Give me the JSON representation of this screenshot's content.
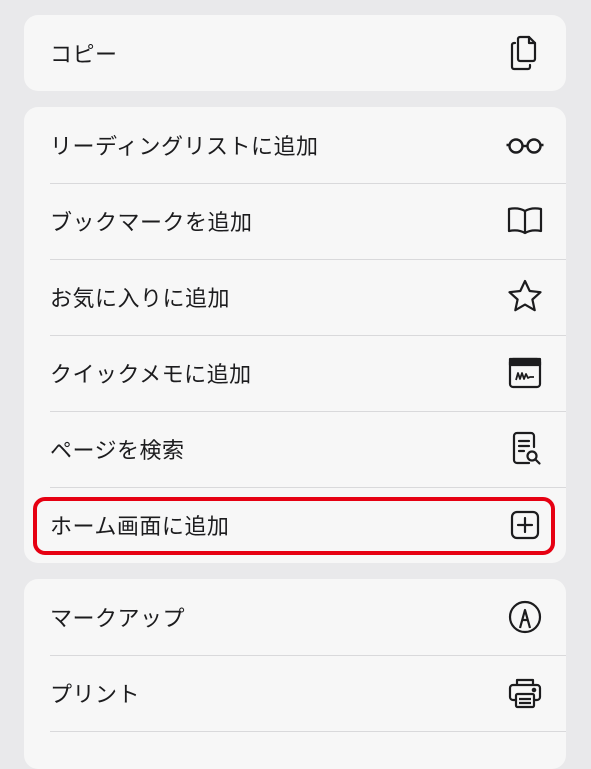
{
  "groups": [
    {
      "items": [
        {
          "label": "コピー",
          "icon": "copy-icon"
        }
      ]
    },
    {
      "items": [
        {
          "label": "リーディングリストに追加",
          "icon": "glasses-icon"
        },
        {
          "label": "ブックマークを追加",
          "icon": "book-icon"
        },
        {
          "label": "お気に入りに追加",
          "icon": "star-icon"
        },
        {
          "label": "クイックメモに追加",
          "icon": "quick-note-icon"
        },
        {
          "label": "ページを検索",
          "icon": "find-in-page-icon"
        },
        {
          "label": "ホーム画面に追加",
          "icon": "add-square-icon"
        }
      ]
    },
    {
      "items": [
        {
          "label": "マークアップ",
          "icon": "markup-pen-icon"
        },
        {
          "label": "プリント",
          "icon": "printer-icon"
        }
      ]
    }
  ],
  "highlight": {
    "color": "#e60012",
    "target": "ホーム画面に追加"
  }
}
